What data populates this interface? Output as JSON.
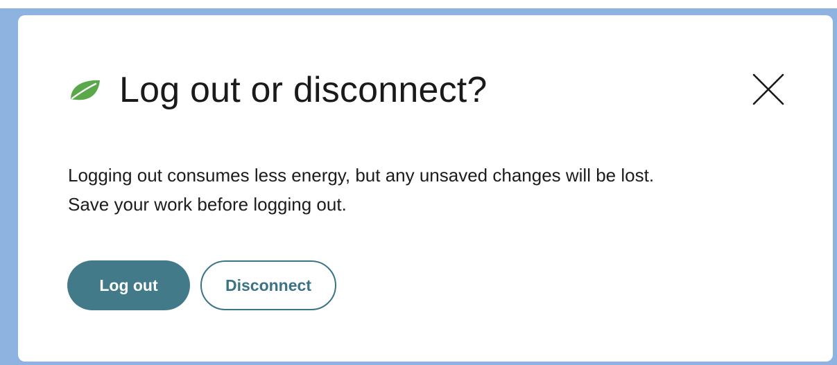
{
  "dialog": {
    "title": "Log out or disconnect?",
    "title_icon": "leaf-icon",
    "close_icon": "close-icon",
    "message_lines": [
      "Logging out consumes less energy, but any unsaved changes will be lost.",
      "Save your work before logging out."
    ],
    "buttons": {
      "primary_label": "Log out",
      "secondary_label": "Disconnect"
    }
  },
  "colors": {
    "backdrop": "#8fb3e0",
    "leaf": "#5aa84a",
    "primary_button": "#427a8a",
    "secondary_button_border": "#3a7386"
  }
}
